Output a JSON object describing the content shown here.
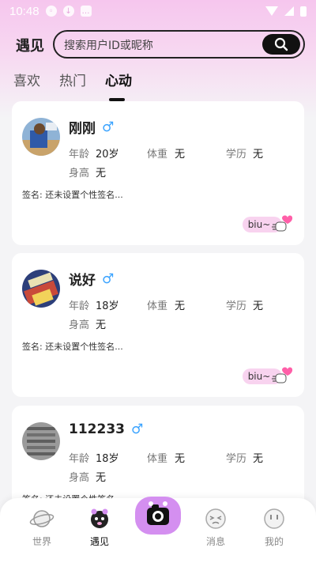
{
  "status_bar": {
    "time": "10:48"
  },
  "header": {
    "title": "遇见",
    "search_placeholder": "搜索用户ID或昵称"
  },
  "tabs": [
    {
      "label": "喜欢",
      "active": false
    },
    {
      "label": "热门",
      "active": false
    },
    {
      "label": "心动",
      "active": true
    }
  ],
  "labels": {
    "age": "年龄",
    "weight": "体重",
    "education": "学历",
    "height": "身高",
    "signature": "签名:",
    "biu": "biu~"
  },
  "users": [
    {
      "name": "刚刚",
      "gender": "♂",
      "age": "20岁",
      "weight": "无",
      "education": "无",
      "height": "无",
      "signature": "还未设置个性签名..."
    },
    {
      "name": "说好",
      "gender": "♂",
      "age": "18岁",
      "weight": "无",
      "education": "无",
      "height": "无",
      "signature": "还未设置个性签名..."
    },
    {
      "name": "112233",
      "gender": "♂",
      "age": "18岁",
      "weight": "无",
      "education": "无",
      "height": "无",
      "signature": "还未设置个性签名..."
    }
  ],
  "nav": [
    {
      "label": "世界",
      "icon": "planet-icon",
      "active": false
    },
    {
      "label": "遇见",
      "icon": "meet-icon",
      "active": true
    },
    {
      "label": "",
      "icon": "camera-icon",
      "active": false
    },
    {
      "label": "消息",
      "icon": "message-face-icon",
      "active": false
    },
    {
      "label": "我的",
      "icon": "profile-face-icon",
      "active": false
    }
  ],
  "colors": {
    "accent": "#f6c6ee",
    "gender_male": "#3aa3ff",
    "biu_pill": "#f8d3ef",
    "center_button": "#d48ff0"
  }
}
